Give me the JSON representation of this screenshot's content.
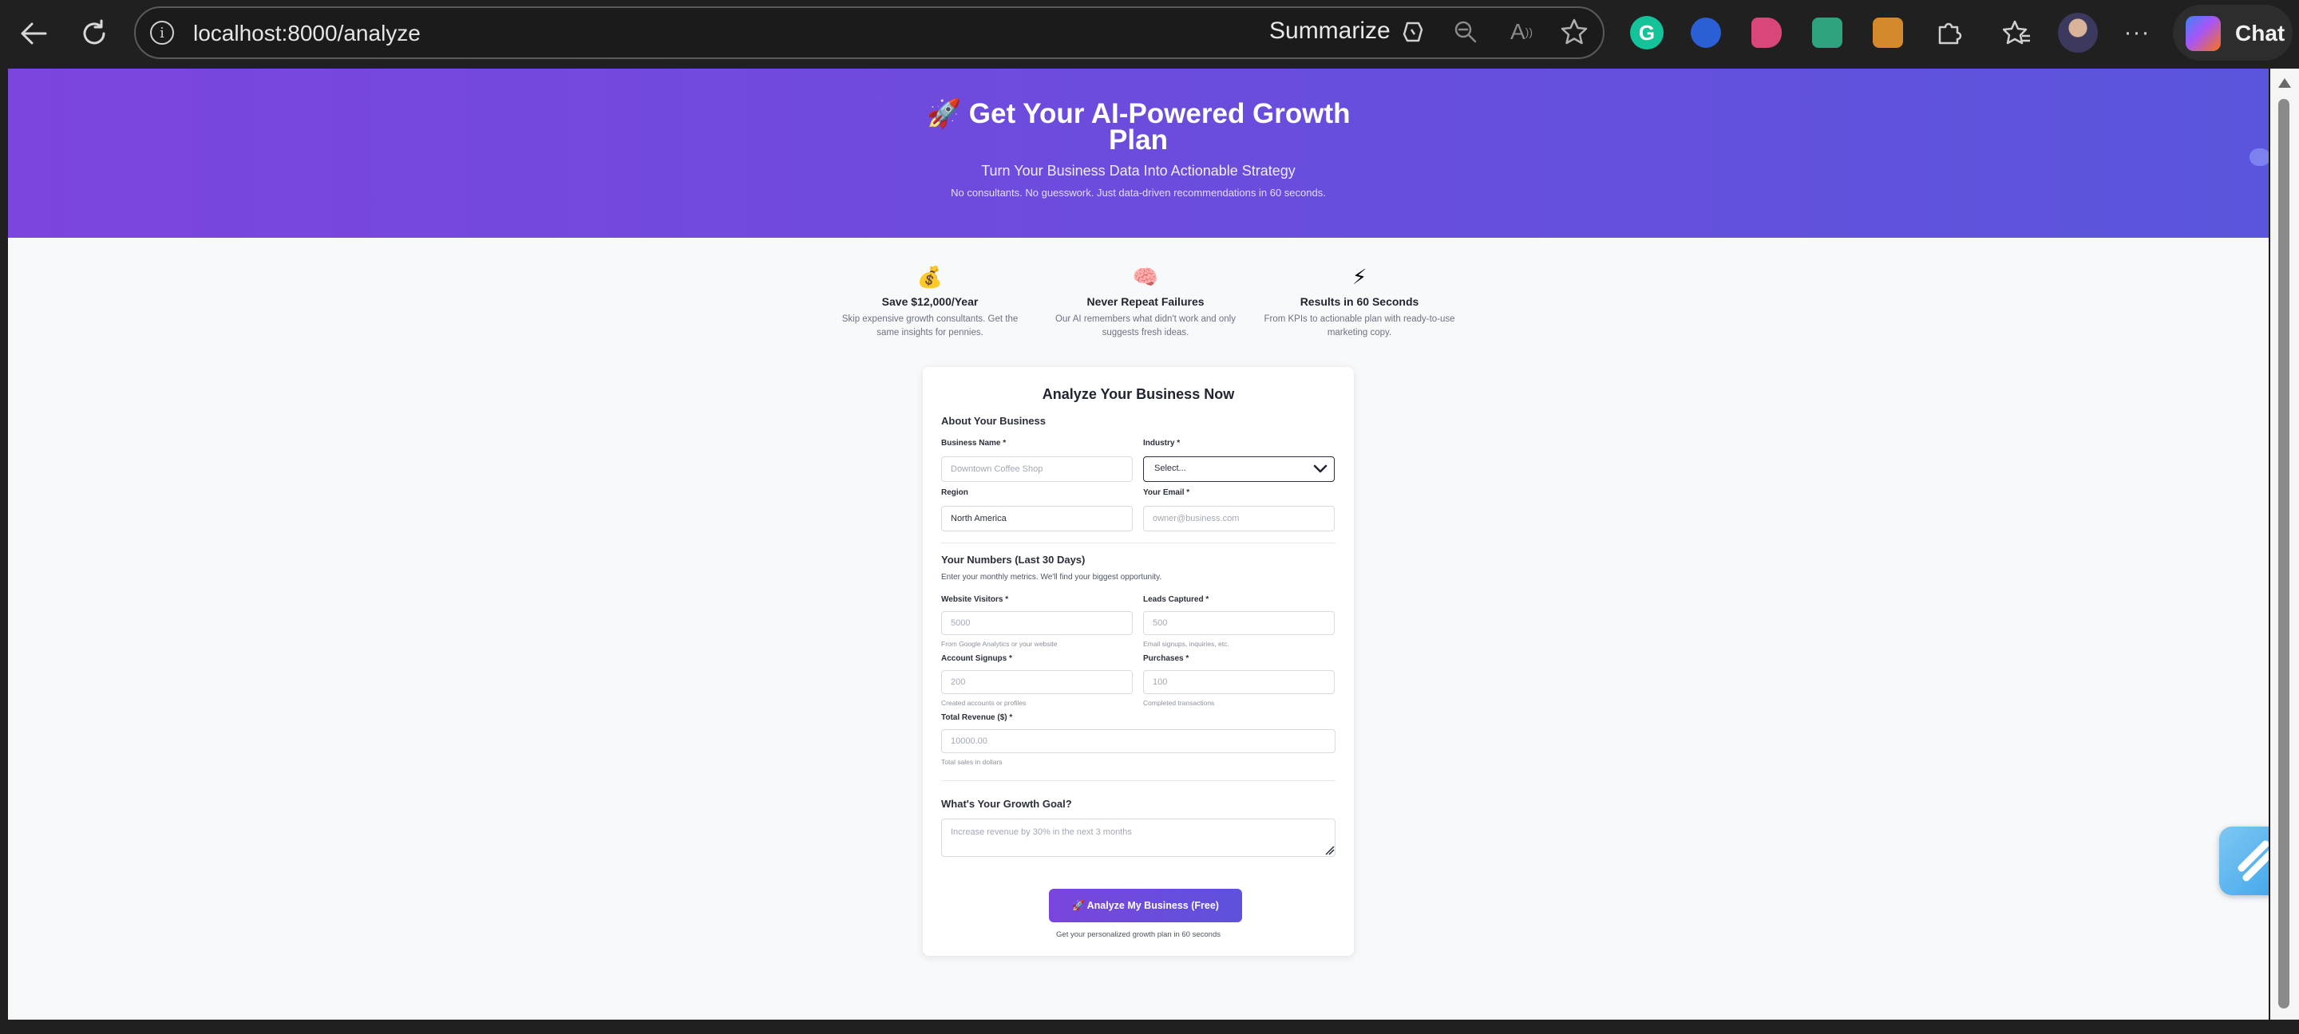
{
  "browser": {
    "url": "localhost:8000/analyze",
    "summarize_label": "Summarize",
    "chat_label": "Chat",
    "icons": [
      "back-icon",
      "refresh-icon",
      "info-icon",
      "copilot-icon",
      "zoom-out-icon",
      "read-aloud-icon",
      "favorite-star-icon",
      "grammarly-icon",
      "extension-icons",
      "extensions-puzzle-icon",
      "favorites-icon",
      "profile-avatar",
      "more-icon"
    ]
  },
  "hero": {
    "icon": "🚀",
    "title": "Get Your AI-Powered Growth Plan",
    "subtitle": "Turn Your Business Data Into Actionable Strategy",
    "tagline": "No consultants. No guesswork. Just data-driven recommendations in 60 seconds.",
    "gradient_start": "#7c45dd",
    "gradient_end": "#5a55dc"
  },
  "features": [
    {
      "icon": "💰",
      "title": "Save $12,000/Year",
      "desc": "Skip expensive growth consultants. Get the same insights for pennies."
    },
    {
      "icon": "🧠",
      "title": "Never Repeat Failures",
      "desc": "Our AI remembers what didn't work and only suggests fresh ideas."
    },
    {
      "icon": "⚡",
      "title": "Results in 60 Seconds",
      "desc": "From KPIs to actionable plan with ready-to-use marketing copy."
    }
  ],
  "form": {
    "title": "Analyze Your Business Now",
    "about": {
      "heading": "About Your Business",
      "business_name_label": "Business Name *",
      "business_name_placeholder": "Downtown Coffee Shop",
      "industry_label": "Industry *",
      "industry_value": "Select...",
      "region_label": "Region",
      "region_value": "North America",
      "email_label": "Your Email *",
      "email_placeholder": "owner@business.com"
    },
    "numbers": {
      "heading": "Your Numbers (Last 30 Days)",
      "note": "Enter your monthly metrics. We'll find your biggest opportunity.",
      "visitors_label": "Website Visitors *",
      "visitors_placeholder": "5000",
      "visitors_hint": "From Google Analytics or your website",
      "leads_label": "Leads Captured *",
      "leads_placeholder": "500",
      "leads_hint": "Email signups, inquiries, etc.",
      "signups_label": "Account Signups *",
      "signups_placeholder": "200",
      "signups_hint": "Created accounts or profiles",
      "purchases_label": "Purchases *",
      "purchases_placeholder": "100",
      "purchases_hint": "Completed transactions",
      "revenue_label": "Total Revenue ($) *",
      "revenue_placeholder": "10000.00",
      "revenue_hint": "Total sales in dollars"
    },
    "goal": {
      "heading": "What's Your Growth Goal?",
      "placeholder": "Increase revenue by 30% in the next 3 months"
    },
    "submit_label": "🚀 Analyze My Business (Free)",
    "submit_note": "Get your personalized growth plan in 60 seconds"
  }
}
